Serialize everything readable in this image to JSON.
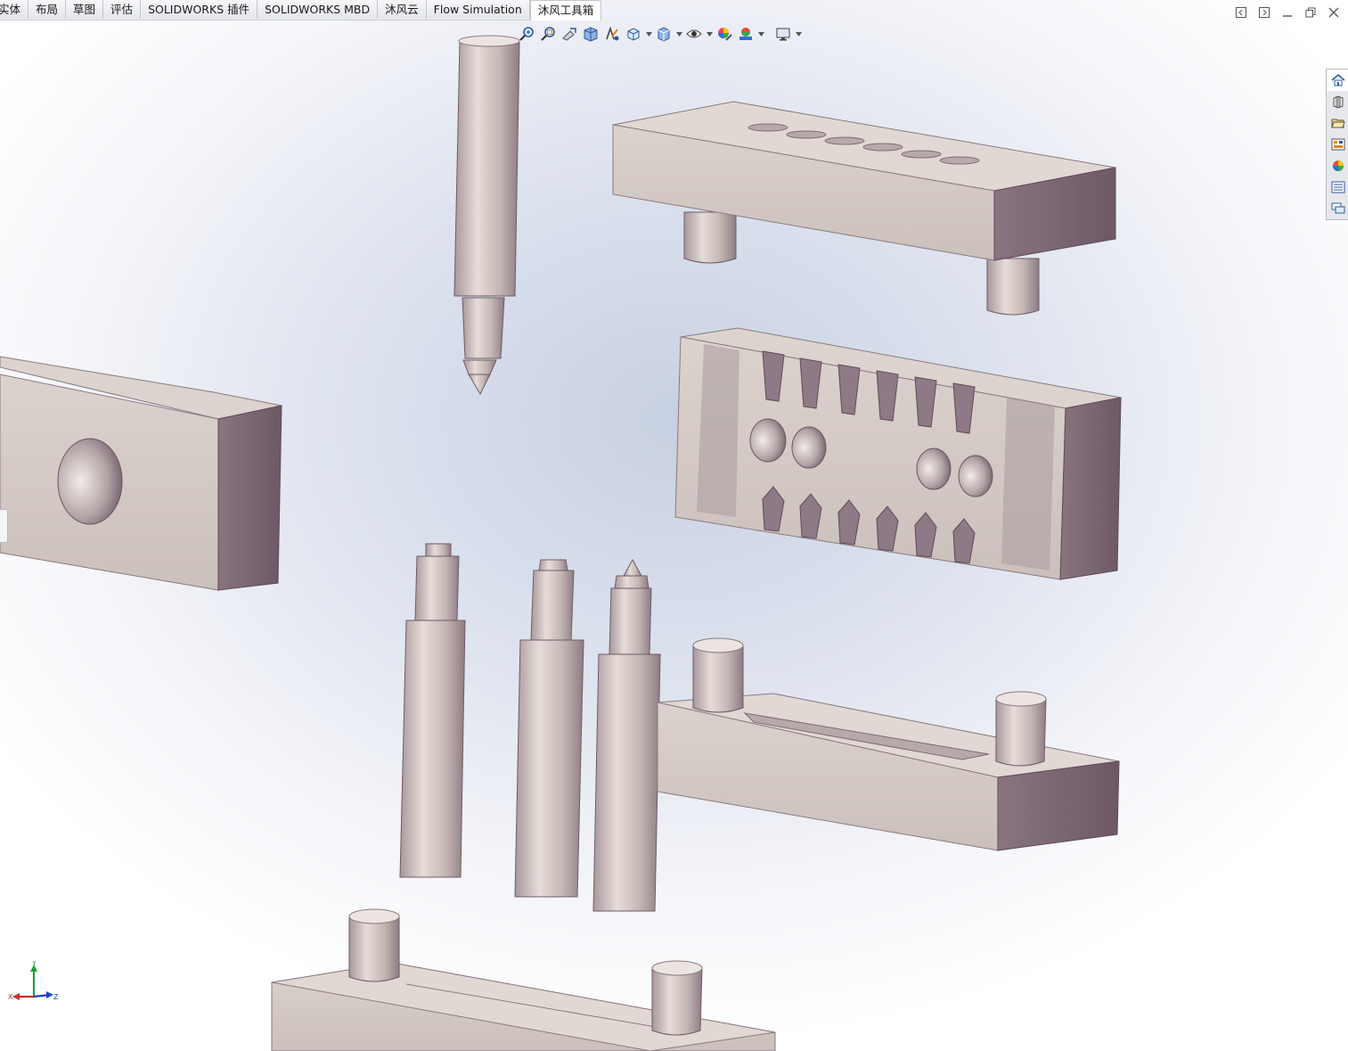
{
  "tabs": [
    {
      "label": "实体",
      "active": false
    },
    {
      "label": "布局",
      "active": false
    },
    {
      "label": "草图",
      "active": false
    },
    {
      "label": "评估",
      "active": false
    },
    {
      "label": "SOLIDWORKS 插件",
      "active": false
    },
    {
      "label": "SOLIDWORKS MBD",
      "active": false
    },
    {
      "label": "沐风云",
      "active": false
    },
    {
      "label": "Flow Simulation",
      "active": false
    },
    {
      "label": "沐风工具箱",
      "active": true
    }
  ],
  "heads_up_toolbar": [
    "zoom-to-fit-icon",
    "zoom-to-area-icon",
    "previous-view-icon",
    "section-view-icon",
    "dynamic-annotation-icon",
    "view-orientation-icon",
    "display-style-icon",
    "hide-show-items-icon",
    "edit-appearance-icon",
    "apply-scene-icon",
    "view-settings-icon"
  ],
  "task_pane": [
    "solidworks-resources-icon",
    "design-library-icon",
    "file-explorer-icon",
    "view-palette-icon",
    "appearances-scenes-icon",
    "custom-properties-icon",
    "forum-icon"
  ],
  "triad": {
    "x": "X",
    "y": "Y",
    "z": "Z"
  },
  "colors": {
    "part": "#d8cdc8",
    "part_shadow": "#7a6571",
    "background_center": "#c7d0e2",
    "background_edge": "#ffffff",
    "tab_bar": "#eceef2"
  }
}
